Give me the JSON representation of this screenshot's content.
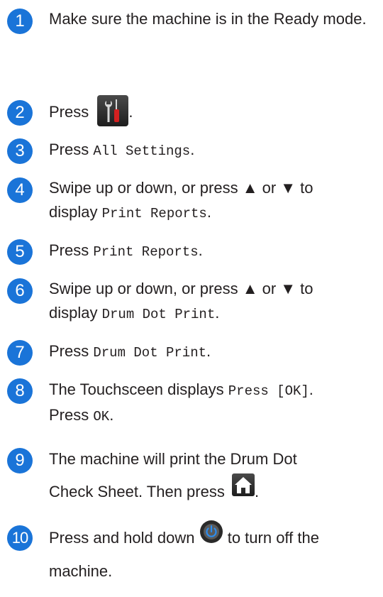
{
  "colors": {
    "badge": "#1a74d8",
    "text": "#231f20"
  },
  "steps": [
    {
      "num": "1",
      "text": "Make sure the machine is in the Ready mode."
    },
    {
      "num": "2",
      "prefix": "Press",
      "icon": "settings-tools-icon",
      "suffix": "."
    },
    {
      "num": "3",
      "prefix": "Press",
      "code": "All Settings",
      "suffix": "."
    },
    {
      "num": "4",
      "line1": "Swipe up or down, or press ▲ or ▼ to",
      "line2_prefix": "display",
      "code": "Print Reports",
      "suffix": "."
    },
    {
      "num": "5",
      "prefix": "Press",
      "code": "Print Reports",
      "suffix": "."
    },
    {
      "num": "6",
      "line1": "Swipe up or down, or press ▲ or ▼ to",
      "line2_prefix": "display",
      "code": "Drum Dot Print",
      "suffix": "."
    },
    {
      "num": "7",
      "prefix": "Press",
      "code": "Drum Dot Print",
      "suffix": "."
    },
    {
      "num": "8",
      "line1_prefix": "The Touchsceen displays",
      "line1_code": "Press [OK]",
      "line1_suffix": ".",
      "line2_prefix": "Press",
      "line2_code": "OK",
      "line2_suffix": "."
    },
    {
      "num": "9",
      "line1": "The machine will print the Drum Dot",
      "line2_prefix": "Check Sheet. Then press",
      "icon": "home-icon",
      "suffix": "."
    },
    {
      "num": "10",
      "prefix": "Press and hold down",
      "icon": "power-icon",
      "mid": "to turn off the",
      "line2": "machine."
    }
  ]
}
